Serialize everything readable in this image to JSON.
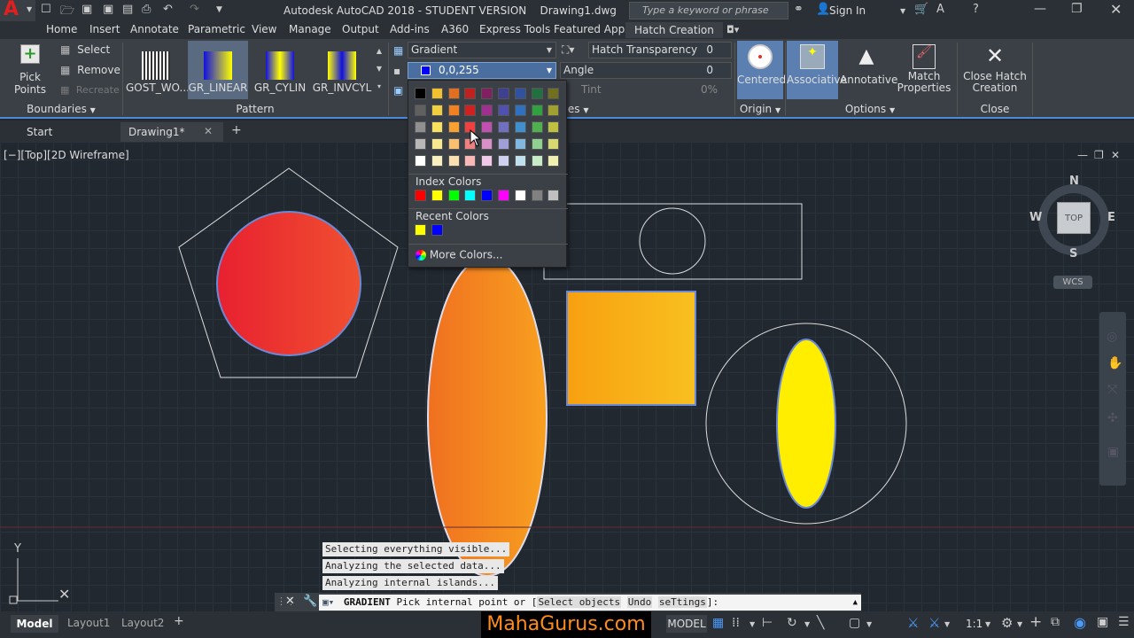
{
  "titlebar": {
    "title": "Autodesk AutoCAD 2018 - STUDENT VERSION    Drawing1.dwg",
    "search_placeholder": "Type a keyword or phrase",
    "sign_in": "Sign In"
  },
  "ribbon_tabs": [
    "Home",
    "Insert",
    "Annotate",
    "Parametric",
    "View",
    "Manage",
    "Output",
    "Add-ins",
    "A360",
    "Express Tools",
    "Featured Apps",
    "Hatch Creation"
  ],
  "ribbon": {
    "pick_points": "Pick Points",
    "select": "Select",
    "remove": "Remove",
    "recreate": "Recreate",
    "boundaries_label": "Boundaries",
    "patterns": [
      "GOST_WO...",
      "GR_LINEAR",
      "GR_CYLIN",
      "GR_INVCYL"
    ],
    "pattern_label": "Pattern",
    "hatch_type": "Gradient",
    "color_value": "0,0,255",
    "hatch_transparency_label": "Hatch Transparency",
    "hatch_transparency_value": "0",
    "angle_label": "Angle",
    "angle_value": "0",
    "tint_label": "Tint",
    "tint_value": "0%",
    "properties_label": "ies",
    "centered": "Centered",
    "origin_label": "Origin",
    "associative": "Associative",
    "annotative": "Annotative",
    "match_properties": "Match Properties",
    "options_label": "Options",
    "close_hatch": "Close Hatch Creation",
    "close_label": "Close"
  },
  "color_popup": {
    "index_colors_label": "Index Colors",
    "recent_colors_label": "Recent Colors",
    "more_colors": "More Colors...",
    "palette_rows": [
      [
        "#000000",
        "#f0c030",
        "#e07020",
        "#c02020",
        "#802060",
        "#404090",
        "#3050a0",
        "#207040",
        "#707020"
      ],
      [
        "#606060",
        "#f0d040",
        "#f08020",
        "#d02020",
        "#a03090",
        "#5050b0",
        "#3070c0",
        "#30a040",
        "#a0a030"
      ],
      [
        "#909090",
        "#f8e060",
        "#f8a030",
        "#f04040",
        "#c050b0",
        "#7070c0",
        "#4090d0",
        "#50b050",
        "#c0c040"
      ],
      [
        "#b8b8b8",
        "#f8e890",
        "#f8c070",
        "#f08080",
        "#d890c8",
        "#a0a0d8",
        "#80b8e0",
        "#90d090",
        "#d8d870"
      ],
      [
        "#ffffff",
        "#f8f0c0",
        "#f8e0b0",
        "#f8b8b8",
        "#f0c8e8",
        "#d0d0f0",
        "#c0e0f0",
        "#c8ecc8",
        "#f0f0b0"
      ]
    ],
    "index_colors": [
      "#ff0000",
      "#ffff00",
      "#00ff00",
      "#00ffff",
      "#0000ff",
      "#ff00ff",
      "#ffffff",
      "#808080",
      "#c0c0c0"
    ],
    "recent_colors": [
      "#ffff00",
      "#0000ff"
    ]
  },
  "doctabs": {
    "start": "Start",
    "drawing": "Drawing1*"
  },
  "viewport": {
    "label": "[−][Top][2D Wireframe]",
    "viewcube_top": "TOP",
    "compass": {
      "n": "N",
      "s": "S",
      "e": "E",
      "w": "W"
    },
    "wcs": "WCS",
    "ucs_y": "Y"
  },
  "command": {
    "messages": [
      "Selecting everything visible...",
      "Analyzing the selected data...",
      "Analyzing internal islands..."
    ],
    "prompt_cmd": "GRADIENT",
    "prompt_text": "Pick internal point or [",
    "opt1": "Select objects",
    "opt2": "Undo",
    "opt3": "seTtings",
    "prompt_end": "]:"
  },
  "status": {
    "model_tab": "Model",
    "layout1": "Layout1",
    "layout2": "Layout2",
    "watermark": "MahaGurus.com",
    "model": "MODEL",
    "scale": "1:1"
  },
  "colors": {
    "accent": "#4a8ad8",
    "autocad_red": "#c8102e",
    "active_button": "#5a7fb0"
  }
}
